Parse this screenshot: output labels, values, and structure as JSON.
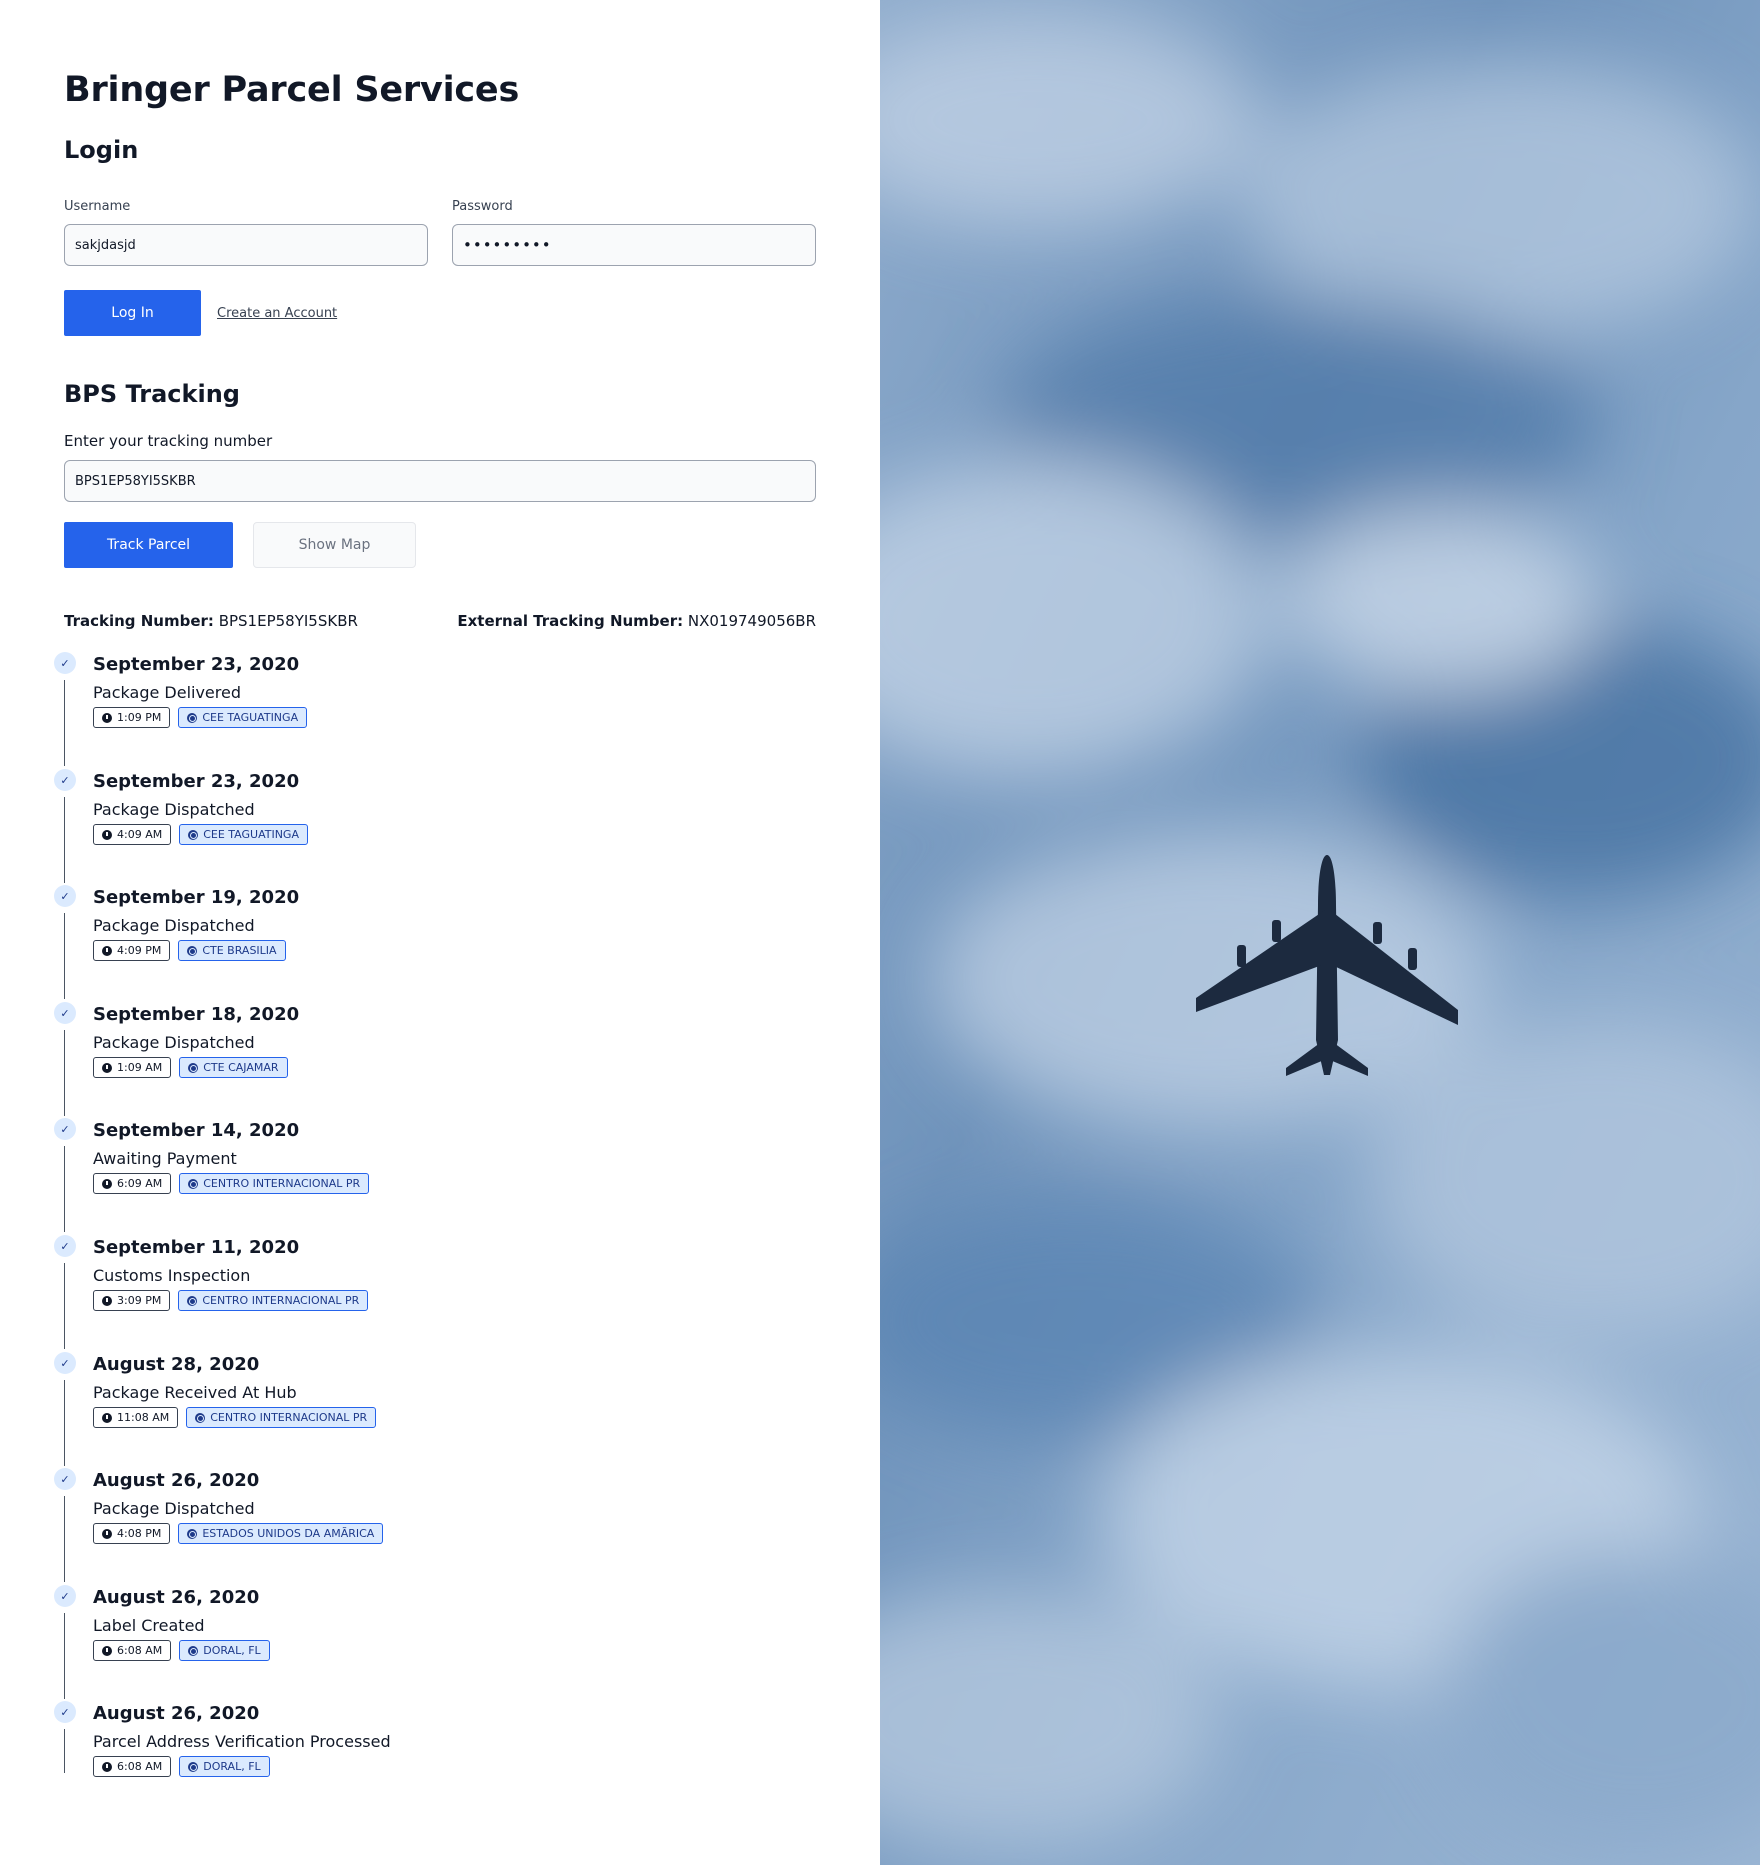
{
  "app": {
    "title": "Bringer Parcel Services"
  },
  "login": {
    "heading": "Login",
    "username_label": "Username",
    "username_value": "sakjdasjd",
    "password_label": "Password",
    "password_value": "•••••••••",
    "login_button": "Log In",
    "create_account_link": "Create an Account"
  },
  "tracking": {
    "heading": "BPS Tracking",
    "input_label": "Enter your tracking number",
    "input_value": "BPS1EP58YI5SKBR",
    "track_button": "Track Parcel",
    "map_button": "Show Map",
    "tracking_number_label": "Tracking Number:",
    "tracking_number": "BPS1EP58YI5SKBR",
    "external_label": "External Tracking Number:",
    "external_number": "NX019749056BR"
  },
  "events": [
    {
      "date": "September 23, 2020",
      "status": "Package Delivered",
      "time": "1:09 PM",
      "location": "CEE TAGUATINGA"
    },
    {
      "date": "September 23, 2020",
      "status": "Package Dispatched",
      "time": "4:09 AM",
      "location": "CEE TAGUATINGA"
    },
    {
      "date": "September 19, 2020",
      "status": "Package Dispatched",
      "time": "4:09 PM",
      "location": "CTE BRASILIA"
    },
    {
      "date": "September 18, 2020",
      "status": "Package Dispatched",
      "time": "1:09 AM",
      "location": "CTE CAJAMAR"
    },
    {
      "date": "September 14, 2020",
      "status": "Awaiting Payment",
      "time": "6:09 AM",
      "location": "CENTRO INTERNACIONAL PR"
    },
    {
      "date": "September 11, 2020",
      "status": "Customs Inspection",
      "time": "3:09 PM",
      "location": "CENTRO INTERNACIONAL PR"
    },
    {
      "date": "August 28, 2020",
      "status": "Package Received At Hub",
      "time": "11:08 AM",
      "location": "CENTRO INTERNACIONAL PR"
    },
    {
      "date": "August 26, 2020",
      "status": "Package Dispatched",
      "time": "4:08 PM",
      "location": "ESTADOS UNIDOS DA AMÃRICA"
    },
    {
      "date": "August 26, 2020",
      "status": "Label Created",
      "time": "6:08 AM",
      "location": "DORAL, FL"
    },
    {
      "date": "August 26, 2020",
      "status": "Parcel Address Verification Processed",
      "time": "6:08 AM",
      "location": "DORAL, FL"
    }
  ],
  "icons": {
    "check": "check-icon",
    "clock": "clock-icon",
    "globe": "globe-icon"
  },
  "colors": {
    "primary": "#2563eb",
    "badge_bg": "#dbeafe",
    "text": "#111827",
    "sky": "#7a9cc2"
  }
}
